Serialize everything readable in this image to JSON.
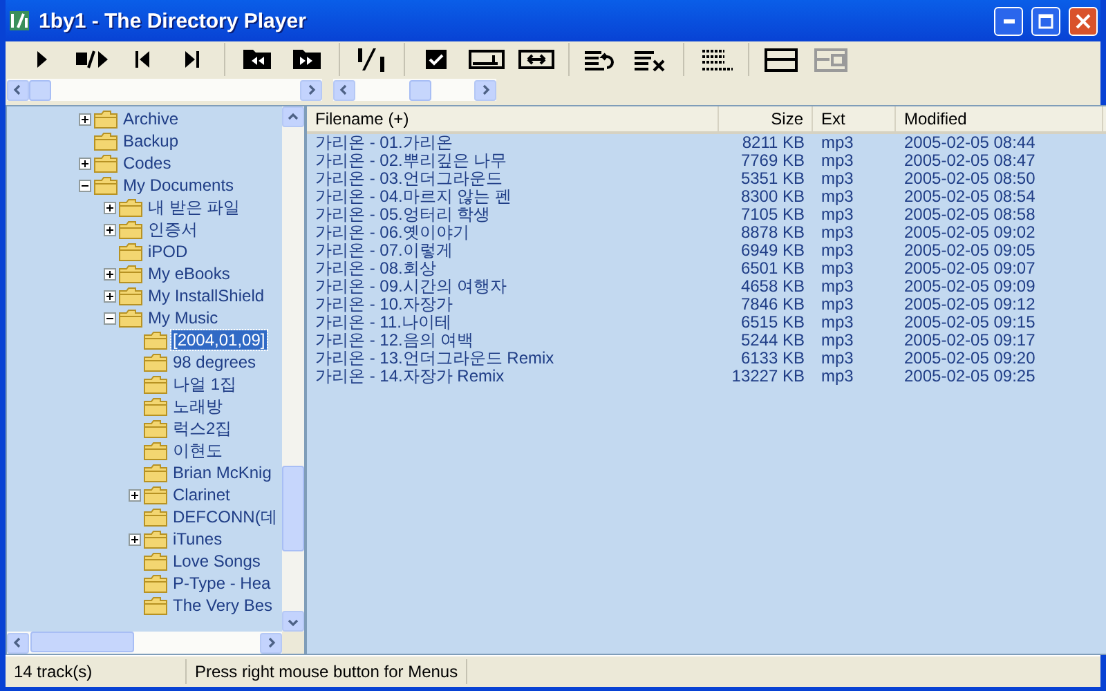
{
  "window": {
    "title": "1by1 - The Directory Player"
  },
  "toolbar": [
    [
      {
        "kind": "play",
        "disabled": false
      },
      {
        "kind": "stop-play",
        "disabled": false
      },
      {
        "kind": "previous",
        "disabled": false
      },
      {
        "kind": "next",
        "disabled": false
      }
    ],
    [
      {
        "kind": "folder-back",
        "disabled": false
      },
      {
        "kind": "folder-forward",
        "disabled": false
      }
    ],
    [
      {
        "kind": "counter",
        "disabled": false
      }
    ],
    [
      {
        "kind": "check",
        "disabled": false
      },
      {
        "kind": "shrink",
        "disabled": false
      },
      {
        "kind": "widen",
        "disabled": false
      }
    ],
    [
      {
        "kind": "repeat",
        "disabled": false
      },
      {
        "kind": "clear",
        "disabled": false
      }
    ],
    [
      {
        "kind": "lines",
        "disabled": false
      }
    ],
    [
      {
        "kind": "panes",
        "disabled": false
      },
      {
        "kind": "panes-alt",
        "disabled": true
      }
    ]
  ],
  "sliders": [
    {
      "level": 0
    },
    {
      "level": 0.55
    }
  ],
  "tree": [
    {
      "label": "Archive",
      "expanded": false,
      "has_children": true,
      "selected": false
    },
    {
      "label": "Backup",
      "has_children": false,
      "selected": false
    },
    {
      "label": "Codes",
      "expanded": false,
      "has_children": true,
      "selected": false
    },
    {
      "label": "My Documents",
      "expanded": true,
      "has_children": true,
      "selected": false,
      "children": [
        {
          "label": "내 받은 파일",
          "expanded": false,
          "has_children": true,
          "selected": false
        },
        {
          "label": "인증서",
          "expanded": false,
          "has_children": true,
          "selected": false
        },
        {
          "label": "iPOD",
          "has_children": false,
          "selected": false
        },
        {
          "label": "My eBooks",
          "expanded": false,
          "has_children": true,
          "selected": false
        },
        {
          "label": "My InstallShield",
          "expanded": false,
          "has_children": true,
          "selected": false
        },
        {
          "label": "My Music",
          "expanded": true,
          "has_children": true,
          "selected": false,
          "children": [
            {
              "label": "[2004,01,09]",
              "has_children": false,
              "selected": true
            },
            {
              "label": "98 degrees",
              "has_children": false,
              "selected": false
            },
            {
              "label": "나얼 1집",
              "has_children": false,
              "selected": false
            },
            {
              "label": "노래방",
              "has_children": false,
              "selected": false
            },
            {
              "label": "럭스2집",
              "has_children": false,
              "selected": false
            },
            {
              "label": "이현도",
              "has_children": false,
              "selected": false
            },
            {
              "label": "Brian McKnig",
              "has_children": false,
              "selected": false
            },
            {
              "label": "Clarinet",
              "expanded": false,
              "has_children": true,
              "selected": false
            },
            {
              "label": "DEFCONN(데",
              "has_children": false,
              "selected": false
            },
            {
              "label": "iTunes",
              "expanded": false,
              "has_children": true,
              "selected": false
            },
            {
              "label": "Love Songs",
              "has_children": false,
              "selected": false
            },
            {
              "label": "P-Type - Hea",
              "has_children": false,
              "selected": false
            },
            {
              "label": "The Very Bes",
              "has_children": false,
              "selected": false
            }
          ]
        }
      ]
    }
  ],
  "table": {
    "columns": [
      "Filename (+)",
      "Size",
      "Ext",
      "Modified"
    ],
    "rows": [
      [
        "가리온 - 01.가리온",
        "8211 KB",
        "mp3",
        "2005-02-05 08:44"
      ],
      [
        "가리온 - 02.뿌리깊은 나무",
        "7769 KB",
        "mp3",
        "2005-02-05 08:47"
      ],
      [
        "가리온 - 03.언더그라운드",
        "5351 KB",
        "mp3",
        "2005-02-05 08:50"
      ],
      [
        "가리온 - 04.마르지 않는 펜",
        "8300 KB",
        "mp3",
        "2005-02-05 08:54"
      ],
      [
        "가리온 - 05.엉터리 학생",
        "7105 KB",
        "mp3",
        "2005-02-05 08:58"
      ],
      [
        "가리온 - 06.옛이야기",
        "8878 KB",
        "mp3",
        "2005-02-05 09:02"
      ],
      [
        "가리온 - 07.이렇게",
        "6949 KB",
        "mp3",
        "2005-02-05 09:05"
      ],
      [
        "가리온 - 08.회상",
        "6501 KB",
        "mp3",
        "2005-02-05 09:07"
      ],
      [
        "가리온 - 09.시간의 여행자",
        "4658 KB",
        "mp3",
        "2005-02-05 09:09"
      ],
      [
        "가리온 - 10.자장가",
        "7846 KB",
        "mp3",
        "2005-02-05 09:12"
      ],
      [
        "가리온 - 11.나이테",
        "6515 KB",
        "mp3",
        "2005-02-05 09:15"
      ],
      [
        "가리온 - 12.음의 여백",
        "5244 KB",
        "mp3",
        "2005-02-05 09:17"
      ],
      [
        "가리온 - 13.언더그라운드 Remix",
        "6133 KB",
        "mp3",
        "2005-02-05 09:20"
      ],
      [
        "가리온 - 14.자장가 Remix",
        "13227 KB",
        "mp3",
        "2005-02-05 09:25"
      ]
    ]
  },
  "status_bar": [
    "14 track(s)",
    "Press right mouse button for Menus"
  ]
}
